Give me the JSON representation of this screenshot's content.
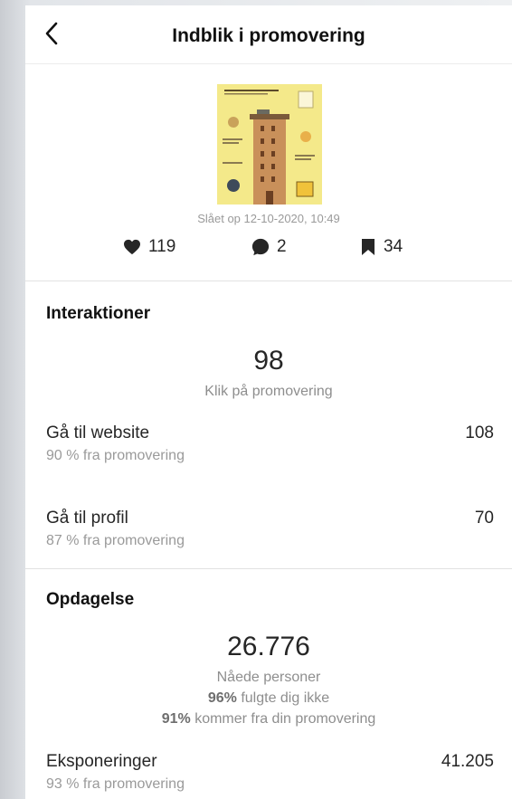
{
  "header": {
    "title": "Indblik i promovering",
    "back_icon": "chevron-left-icon"
  },
  "post": {
    "posted_text": "Slået op 12-10-2020, 10:49",
    "likes": "119",
    "comments": "2",
    "saves": "34"
  },
  "interactions": {
    "title": "Interaktioner",
    "total": "98",
    "total_label": "Klik på promovering",
    "rows": [
      {
        "label": "Gå til website",
        "value": "108",
        "sub": "90 % fra promovering"
      },
      {
        "label": "Gå til profil",
        "value": "70",
        "sub": "87 % fra promovering"
      }
    ]
  },
  "discovery": {
    "title": "Opdagelse",
    "total": "26.776",
    "total_label": "Nåede personer",
    "line1_pct": "96%",
    "line1_text": " fulgte dig ikke",
    "line2_pct": "91%",
    "line2_text": " kommer fra din promovering",
    "rows": [
      {
        "label": "Eksponeringer",
        "value": "41.205",
        "sub": "93 % fra promovering"
      }
    ]
  },
  "colors": {
    "text": "#262626",
    "muted": "#9a9a9a",
    "divider": "#e2e2e2"
  }
}
